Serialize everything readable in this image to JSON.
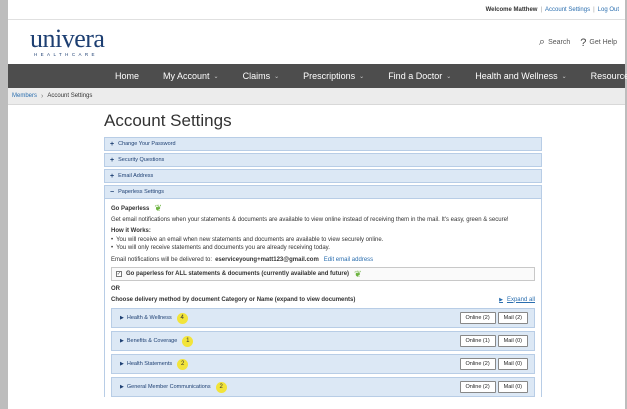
{
  "utility": {
    "welcome": "Welcome Matthew",
    "links": [
      "Account Settings",
      "Log Out"
    ]
  },
  "brand": {
    "logo_word": "univera",
    "logo_sub": "HEALTHCARE",
    "search": "Search",
    "help": "Get Help"
  },
  "nav": [
    "Home",
    "My Account",
    "Claims",
    "Prescriptions",
    "Find a Doctor",
    "Health and Wellness",
    "Resources"
  ],
  "breadcrumb": {
    "parent": "Members",
    "current": "Account Settings"
  },
  "page": {
    "title": "Account Settings"
  },
  "accordions": [
    {
      "sign": "+",
      "label": "Change Your Password"
    },
    {
      "sign": "+",
      "label": "Security Questions"
    },
    {
      "sign": "+",
      "label": "Email Address"
    },
    {
      "sign": "−",
      "label": "Paperless Settings"
    }
  ],
  "paperless": {
    "heading": "Go Paperless",
    "intro": "Get email notifications when your statements & documents are available to view online instead of receiving them in the mail. It's easy, green & secure!",
    "how_heading": "How it Works:",
    "bullets": [
      "You will receive an email when new statements and documents are available to view securely online.",
      "You will only receive statements and documents you are already receiving today."
    ],
    "email_prefix": "Email notifications will be delivered to:",
    "email": "eserviceyoung+matt123@gmail.com",
    "edit_link": "Edit email address",
    "all_label": "Go paperless for ALL statements & documents (currently available and future)",
    "or": "OR",
    "choose": "Choose delivery method by document Category or Name (expand to view documents)",
    "expand_all": "Expand all"
  },
  "categories": [
    {
      "name": "Health & Wellness",
      "count": "4",
      "online": "Online (2)",
      "mail": "Mail (2)"
    },
    {
      "name": "Benefits & Coverage",
      "count": "1",
      "online": "Online (1)",
      "mail": "Mail (0)"
    },
    {
      "name": "Health Statements",
      "count": "2",
      "online": "Online (2)",
      "mail": "Mail (0)"
    },
    {
      "name": "General Member Communications",
      "count": "2",
      "online": "Online (2)",
      "mail": "Mail (0)"
    }
  ],
  "colors": {
    "brand_navy": "#1d3f72",
    "nav_bg": "#4d4d4d",
    "panel_blue": "#dce8f5",
    "badge_yellow": "#f2e43a",
    "leaf_green": "#6cb33f",
    "link_blue": "#2a6eaf"
  }
}
